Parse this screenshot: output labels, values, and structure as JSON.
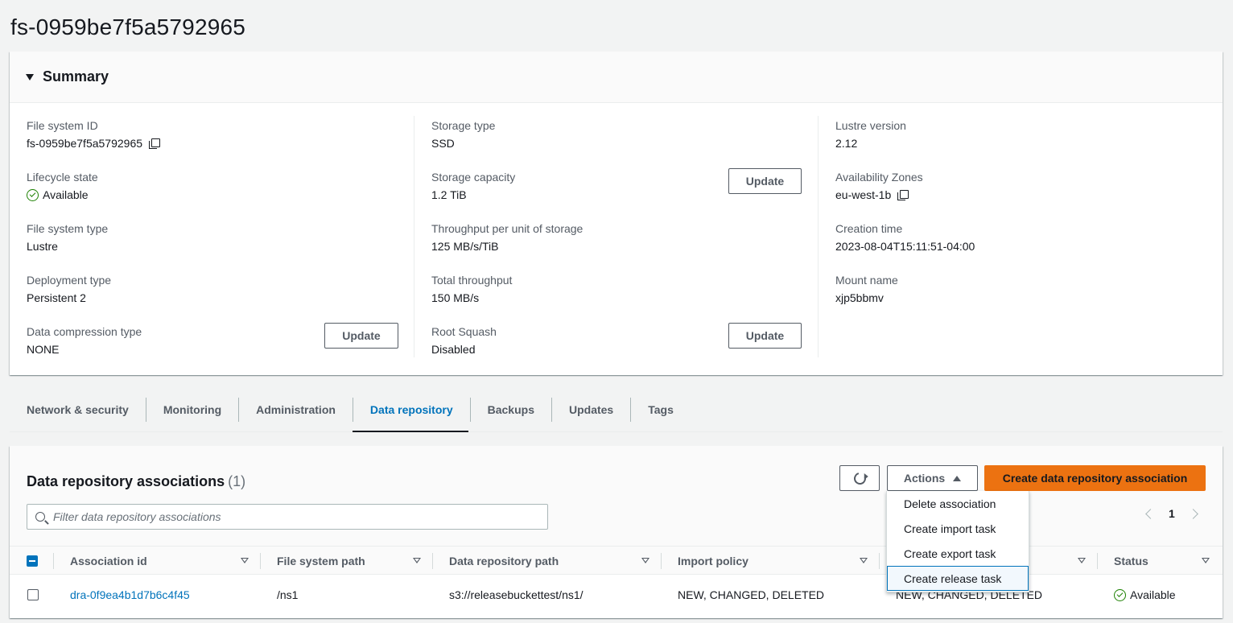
{
  "page": {
    "title": "fs-0959be7f5a5792965"
  },
  "summary": {
    "title": "Summary",
    "col1": {
      "file_system_id_label": "File system ID",
      "file_system_id_value": "fs-0959be7f5a5792965",
      "lifecycle_label": "Lifecycle state",
      "lifecycle_value": "Available",
      "fs_type_label": "File system type",
      "fs_type_value": "Lustre",
      "deployment_label": "Deployment type",
      "deployment_value": "Persistent 2",
      "compression_label": "Data compression type",
      "compression_value": "NONE",
      "compression_update": "Update"
    },
    "col2": {
      "storage_type_label": "Storage type",
      "storage_type_value": "SSD",
      "capacity_label": "Storage capacity",
      "capacity_value": "1.2 TiB",
      "capacity_update": "Update",
      "throughput_unit_label": "Throughput per unit of storage",
      "throughput_unit_value": "125 MB/s/TiB",
      "total_throughput_label": "Total throughput",
      "total_throughput_value": "150 MB/s",
      "root_squash_label": "Root Squash",
      "root_squash_value": "Disabled",
      "root_squash_update": "Update"
    },
    "col3": {
      "lustre_version_label": "Lustre version",
      "lustre_version_value": "2.12",
      "az_label": "Availability Zones",
      "az_value": "eu-west-1b",
      "creation_label": "Creation time",
      "creation_value": "2023-08-04T15:11:51-04:00",
      "mount_label": "Mount name",
      "mount_value": "xjp5bbmv"
    }
  },
  "tabs": [
    {
      "label": "Network & security",
      "active": false
    },
    {
      "label": "Monitoring",
      "active": false
    },
    {
      "label": "Administration",
      "active": false
    },
    {
      "label": "Data repository",
      "active": true
    },
    {
      "label": "Backups",
      "active": false
    },
    {
      "label": "Updates",
      "active": false
    },
    {
      "label": "Tags",
      "active": false
    }
  ],
  "dra": {
    "title": "Data repository associations",
    "count": "(1)",
    "actions_label": "Actions",
    "create_label": "Create data repository association",
    "filter_placeholder": "Filter data repository associations",
    "page_number": "1",
    "columns": [
      "Association id",
      "File system path",
      "Data repository path",
      "Import policy",
      "",
      "Status"
    ],
    "rows": [
      {
        "association_id": "dra-0f9ea4b1d7b6c4f45",
        "fs_path": "/ns1",
        "repo_path": "s3://releasebuckettest/ns1/",
        "import_policy": "NEW, CHANGED, DELETED",
        "export_policy": "NEW, CHANGED, DELETED",
        "status": "Available"
      }
    ],
    "menu": [
      "Delete association",
      "Create import task",
      "Create export task",
      "Create release task"
    ]
  },
  "colors": {
    "accent": "#0073bb",
    "primary_button": "#ec7211",
    "success": "#1d8102"
  }
}
